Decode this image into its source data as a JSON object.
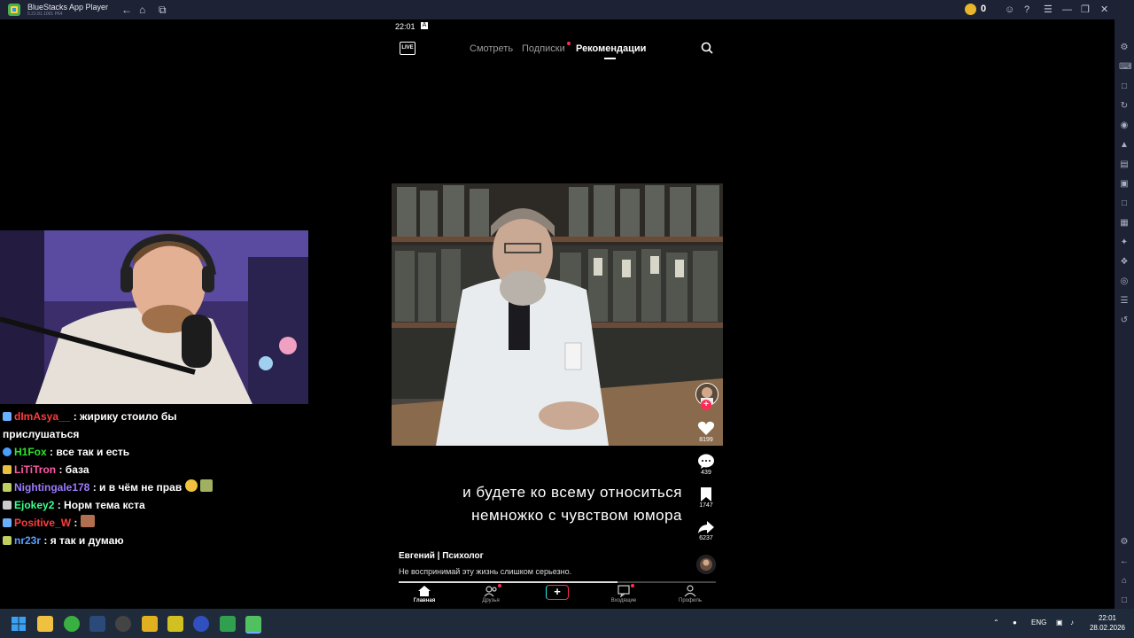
{
  "window": {
    "title": "BlueStacks App Player",
    "version": "5.22.81.1001 P64"
  },
  "topbar": {
    "coins": "0"
  },
  "status": {
    "time": "22:01",
    "icon": "A"
  },
  "app_header": {
    "live_label": "LIVE",
    "tabs": [
      {
        "label": "Смотреть"
      },
      {
        "label": "Подписки"
      },
      {
        "label": "Рекомендации"
      }
    ]
  },
  "video": {
    "caption_lines": [
      "и будете ко всему относиться",
      "немножко с чувством юмора"
    ],
    "author": "Евгений | Психолог",
    "description": "Не воспринимай эту жизнь слишком серьезно.",
    "progress": 0.69
  },
  "actions": {
    "likes": "8199",
    "comments": "439",
    "saves": "1747",
    "shares": "6237"
  },
  "bottom_nav": [
    {
      "label": "Главная"
    },
    {
      "label": "Друзья"
    },
    {
      "label": "+"
    },
    {
      "label": "Входящие"
    },
    {
      "label": "Профиль"
    }
  ],
  "chat": [
    {
      "user": "dImAsya__",
      "text": "жирику стоило бы",
      "color": "#ff3c3c"
    },
    {
      "user": "",
      "text": "прислушаться",
      "color": "#ffffff"
    },
    {
      "user": "H1Fox",
      "text": "все так и есть",
      "color": "#29e629"
    },
    {
      "user": "LiTiTron",
      "text": "база",
      "color": "#ff5aa8"
    },
    {
      "user": "Nightingale178",
      "text": "и в чём не прав",
      "color": "#9d7bff"
    },
    {
      "user": "Ejokey2",
      "text": "Норм тема кста",
      "color": "#3cff8c"
    },
    {
      "user": "Positive_W",
      "text": "",
      "color": "#ff3c3c"
    },
    {
      "user": "nr23r",
      "text": "я так и думаю",
      "color": "#5aa0ff"
    }
  ],
  "tray": {
    "lang": "ENG",
    "time": "22:01",
    "date": "28.02.2026"
  }
}
